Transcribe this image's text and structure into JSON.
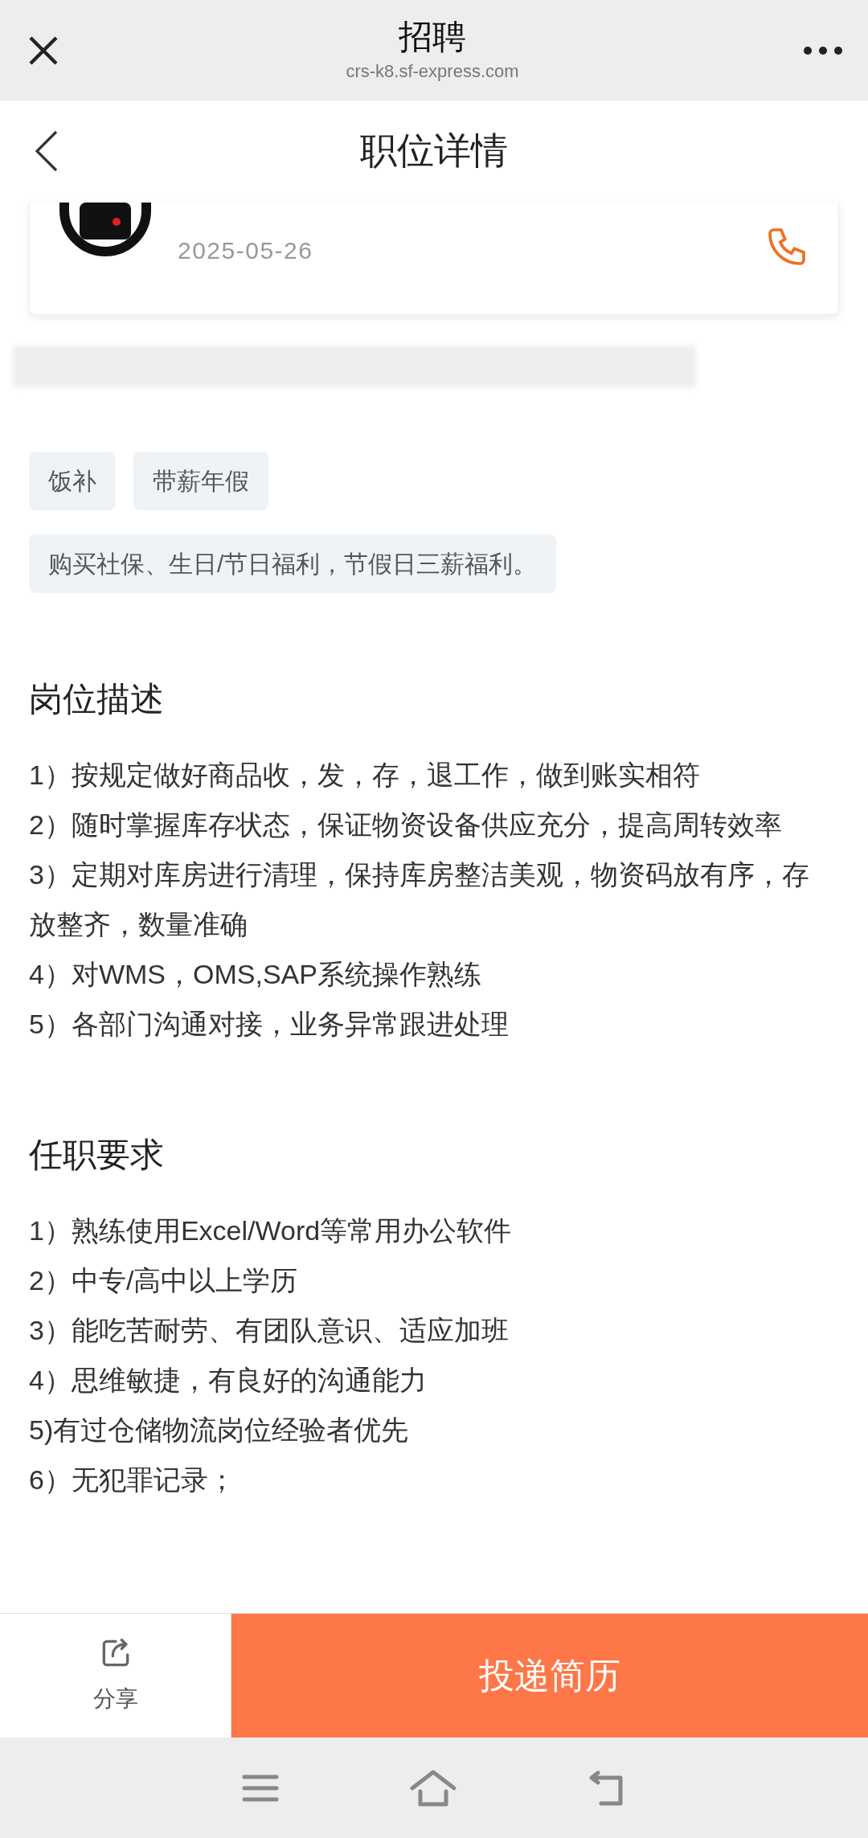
{
  "browser_bar": {
    "title": "招聘",
    "url": "crs-k8.sf-express.com"
  },
  "header": {
    "title": "职位详情"
  },
  "company_card": {
    "date": "2025-05-26"
  },
  "tags": [
    "饭补",
    "带薪年假"
  ],
  "benefits_note": "购买社保、生日/节日福利，节假日三薪福利。",
  "sections": [
    {
      "title": "岗位描述",
      "lines": [
        "1）按规定做好商品收，发，存，退工作，做到账实相符",
        "2）随时掌握库存状态，保证物资设备供应充分，提高周转效率",
        "3）定期对库房进行清理，保持库房整洁美观，物资码放有序，存放整齐，数量准确",
        "4）对WMS，OMS,SAP系统操作熟练",
        "5）各部门沟通对接，业务异常跟进处理"
      ]
    },
    {
      "title": "任职要求",
      "lines": [
        "1）熟练使用Excel/Word等常用办公软件",
        "2）中专/高中以上学历",
        "3）能吃苦耐劳、有团队意识、适应加班",
        "4）思维敏捷，有良好的沟通能力",
        "5)有过仓储物流岗位经验者优先",
        "6）无犯罪记录；"
      ]
    }
  ],
  "bottom_bar": {
    "share": "分享",
    "apply": "投递简历"
  }
}
